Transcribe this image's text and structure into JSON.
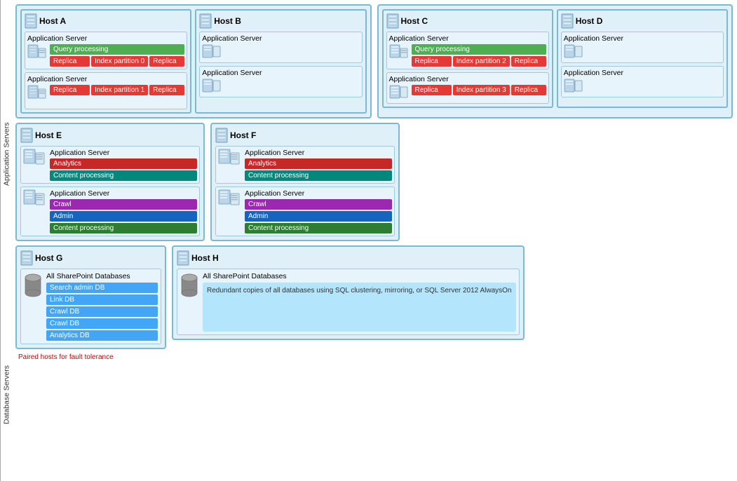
{
  "labels": {
    "appServers": "Application Servers",
    "dbServers": "Database Servers",
    "pairedHosts": "Paired hosts for fault tolerance"
  },
  "hostsRowTop": {
    "hostA": {
      "name": "Host A",
      "servers": [
        {
          "title": "Application Server",
          "bars": [
            {
              "label": "Query processing",
              "color": "green"
            },
            {
              "label": "Replica",
              "color": "red"
            }
          ],
          "indexPartition": "Index partition 0",
          "replicaRight": "Replica"
        },
        {
          "title": "Application Server",
          "bars": [
            {
              "label": "Replica",
              "color": "red"
            }
          ],
          "indexPartition": "Index partition 1",
          "replicaRight": "Replica"
        }
      ]
    },
    "hostB": {
      "name": "Host B",
      "servers": [
        {
          "title": "Application Server",
          "bars": []
        },
        {
          "title": "Application Server",
          "bars": []
        }
      ]
    },
    "hostC": {
      "name": "Host C",
      "servers": [
        {
          "title": "Application Server",
          "bars": [
            {
              "label": "Query processing",
              "color": "green"
            },
            {
              "label": "Replica",
              "color": "red"
            }
          ],
          "indexPartition": "Index partition 2",
          "replicaRight": "Replica"
        },
        {
          "title": "Application Server",
          "bars": [
            {
              "label": "Replica",
              "color": "red"
            }
          ],
          "indexPartition": "Index partition 3",
          "replicaRight": "Replica"
        }
      ]
    },
    "hostD": {
      "name": "Host D",
      "servers": [
        {
          "title": "Application Server",
          "bars": []
        },
        {
          "title": "Application Server",
          "bars": []
        }
      ]
    }
  },
  "hostsRowMiddle": {
    "hostE": {
      "name": "Host E",
      "servers": [
        {
          "title": "Application Server",
          "bars": [
            {
              "label": "Analytics",
              "color": "dark-red"
            },
            {
              "label": "Content processing",
              "color": "teal"
            }
          ]
        },
        {
          "title": "Application Server",
          "bars": [
            {
              "label": "Crawl",
              "color": "purple"
            },
            {
              "label": "Admin",
              "color": "blue"
            },
            {
              "label": "Content processing",
              "color": "content"
            }
          ]
        }
      ]
    },
    "hostF": {
      "name": "Host F",
      "servers": [
        {
          "title": "Application Server",
          "bars": [
            {
              "label": "Analytics",
              "color": "dark-red"
            },
            {
              "label": "Content processing",
              "color": "teal"
            }
          ]
        },
        {
          "title": "Application Server",
          "bars": [
            {
              "label": "Crawl",
              "color": "purple"
            },
            {
              "label": "Admin",
              "color": "blue"
            },
            {
              "label": "Content processing",
              "color": "content"
            }
          ]
        }
      ]
    }
  },
  "hostsRowBottom": {
    "hostG": {
      "name": "Host G",
      "dbLabel": "All SharePoint Databases",
      "dbs": [
        {
          "label": "Search admin DB"
        },
        {
          "label": "Link DB"
        },
        {
          "label": "Crawl DB"
        },
        {
          "label": "Crawl DB"
        },
        {
          "label": "Analytics DB"
        }
      ]
    },
    "hostH": {
      "name": "Host H",
      "dbLabel": "All SharePoint Databases",
      "redundantText": "Redundant copies of all databases using SQL clustering, mirroring, or SQL Server 2012 AlwaysOn"
    }
  }
}
